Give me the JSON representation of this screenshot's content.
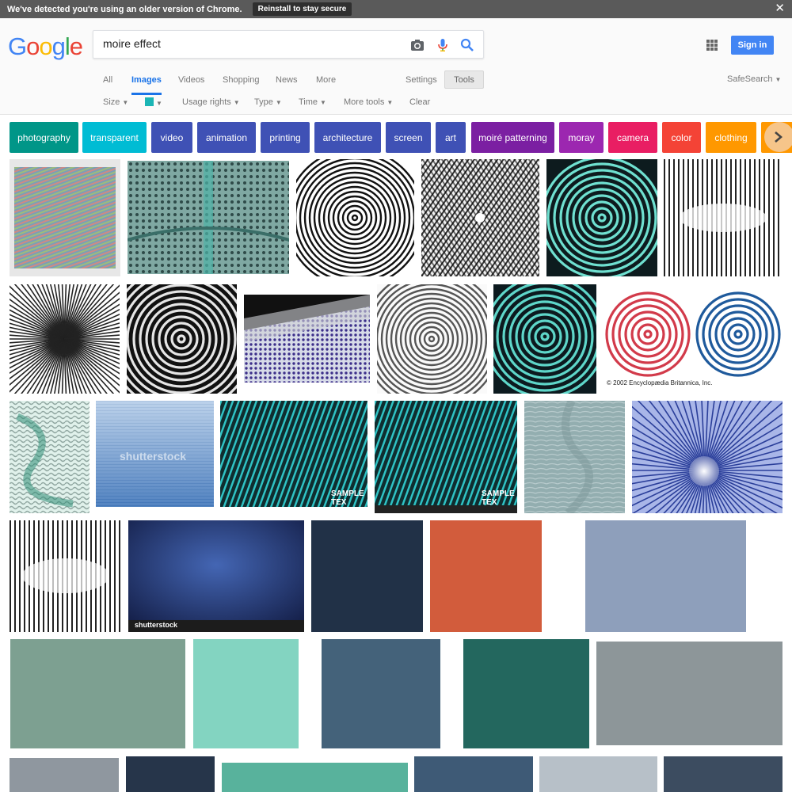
{
  "banner": {
    "message": "We've detected you're using an older version of Chrome.",
    "button": "Reinstall to stay secure",
    "close": "✕"
  },
  "logo": {
    "letters": [
      "G",
      "o",
      "o",
      "g",
      "l",
      "e"
    ],
    "colors": [
      "#4285f4",
      "#ea4335",
      "#fbbc05",
      "#4285f4",
      "#34a853",
      "#ea4335"
    ]
  },
  "search": {
    "query": "moire effect"
  },
  "header": {
    "signin": "Sign in"
  },
  "tabs": {
    "all": "All",
    "images": "Images",
    "videos": "Videos",
    "shopping": "Shopping",
    "news": "News",
    "more": "More",
    "settings": "Settings",
    "tools": "Tools",
    "safesearch": "SafeSearch"
  },
  "toolbar": {
    "size": "Size",
    "usage": "Usage rights",
    "type": "Type",
    "time": "Time",
    "more_tools": "More tools",
    "clear": "Clear"
  },
  "chips": [
    {
      "label": "photography",
      "color": "#009688"
    },
    {
      "label": "transparent",
      "color": "#00bcd4"
    },
    {
      "label": "video",
      "color": "#3f51b5"
    },
    {
      "label": "animation",
      "color": "#3f51b5"
    },
    {
      "label": "printing",
      "color": "#3f51b5"
    },
    {
      "label": "architecture",
      "color": "#3f51b5"
    },
    {
      "label": "screen",
      "color": "#3f51b5"
    },
    {
      "label": "art",
      "color": "#3f51b5"
    },
    {
      "label": "moiré patterning",
      "color": "#7b1fa2"
    },
    {
      "label": "moray",
      "color": "#9c27b0"
    },
    {
      "label": "camera",
      "color": "#e91e63"
    },
    {
      "label": "color",
      "color": "#f44336"
    },
    {
      "label": "clothing",
      "color": "#ff9800"
    },
    {
      "label": "",
      "color": "#ff9800"
    }
  ],
  "image_captions": {
    "stock1": "shutterstock",
    "sample": "SAMPLE TEX",
    "stock2": "shutterstock",
    "britannica": "© 2002 Encyclopædia Britannica, Inc."
  },
  "swatches": {
    "navy": "#213147",
    "orange": "#d25c3c",
    "periwinkle": "#8e9fbb",
    "sage": "#7da091",
    "mint": "#83d4c1",
    "slate": "#44627a",
    "forest": "#23675e",
    "gray": "#8d9699",
    "steel": "#8f979f",
    "darknavy": "#26354a",
    "teal": "#58b29c",
    "denim": "#3e5a76",
    "silver": "#b7c0c8",
    "ink": "#3c4c60"
  }
}
